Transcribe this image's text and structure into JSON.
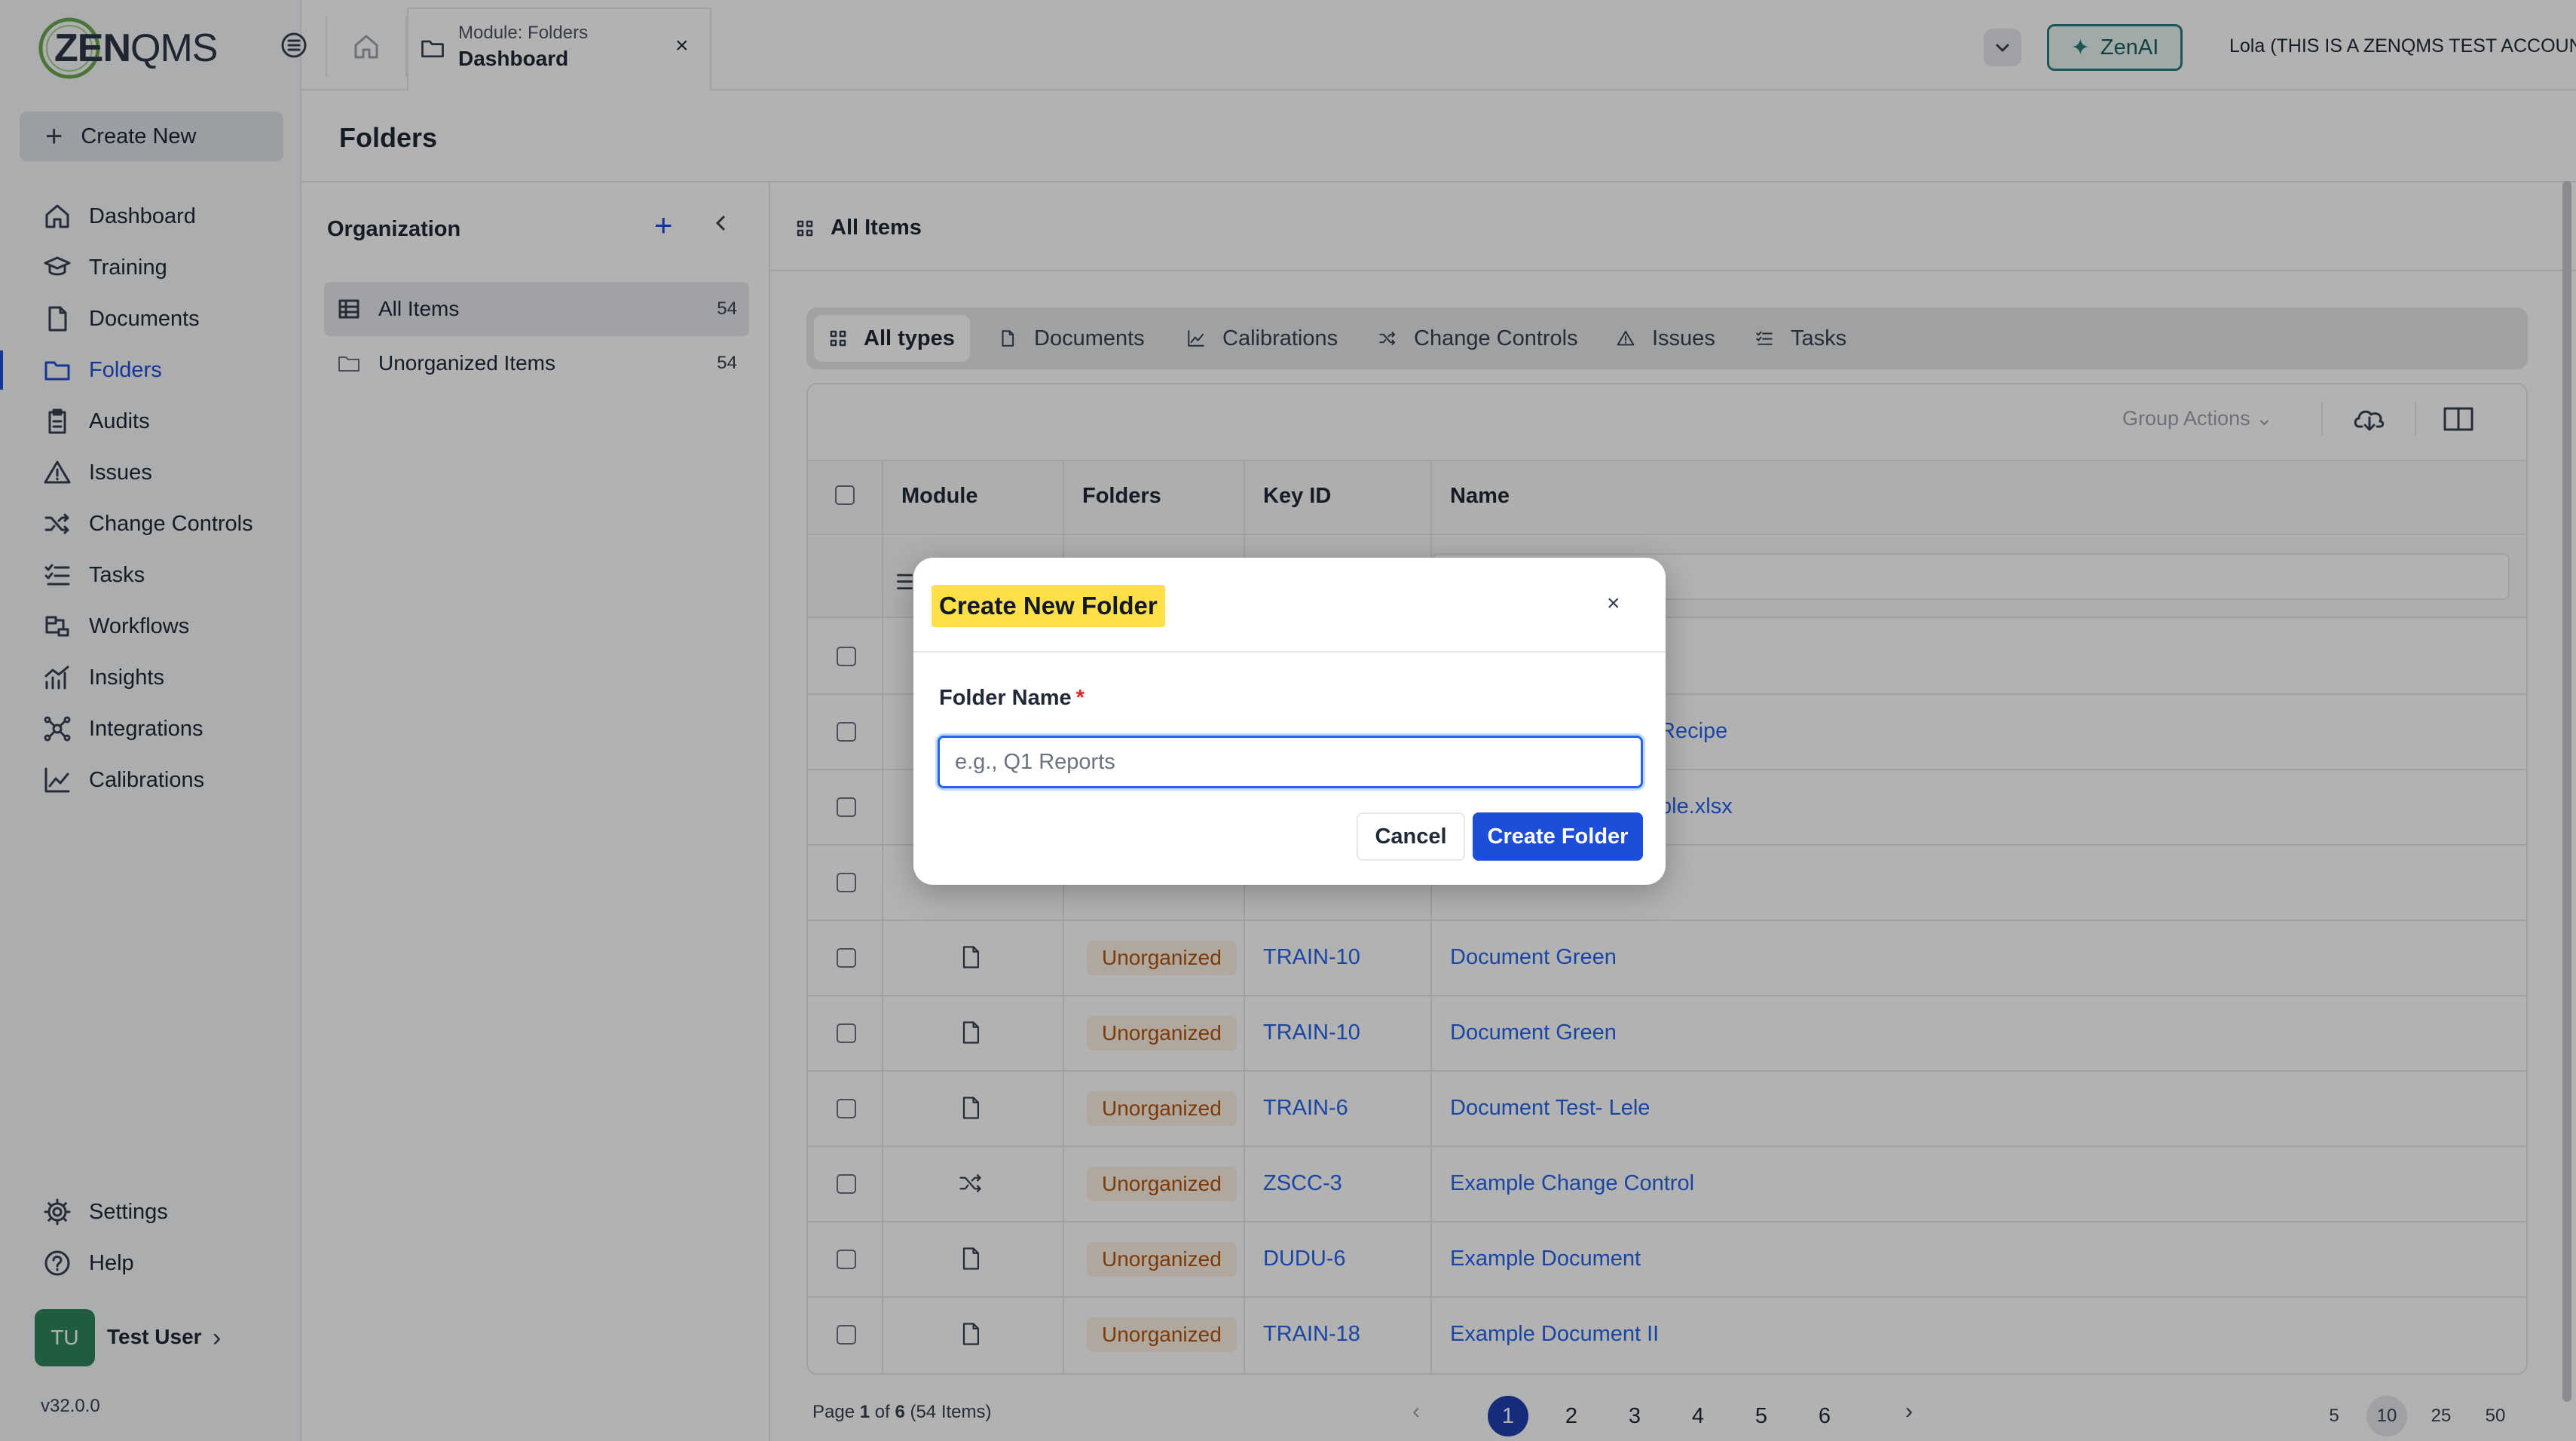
{
  "app": {
    "logo_zen": "ZEN",
    "logo_qms": "QMS"
  },
  "sidebar": {
    "create_new": "Create New",
    "items": [
      {
        "label": "Dashboard",
        "icon": "home-icon"
      },
      {
        "label": "Training",
        "icon": "graduation-cap-icon"
      },
      {
        "label": "Documents",
        "icon": "document-icon"
      },
      {
        "label": "Folders",
        "icon": "folder-icon",
        "active": true
      },
      {
        "label": "Audits",
        "icon": "clipboard-icon"
      },
      {
        "label": "Issues",
        "icon": "warning-icon"
      },
      {
        "label": "Change Controls",
        "icon": "shuffle-icon"
      },
      {
        "label": "Tasks",
        "icon": "checklist-icon"
      },
      {
        "label": "Workflows",
        "icon": "workflow-icon"
      },
      {
        "label": "Insights",
        "icon": "insights-icon"
      },
      {
        "label": "Integrations",
        "icon": "integrations-icon"
      },
      {
        "label": "Calibrations",
        "icon": "chart-icon"
      }
    ],
    "settings": "Settings",
    "help": "Help",
    "user_initials": "TU",
    "user_name": "Test User",
    "version": "v32.0.0"
  },
  "topbar": {
    "tab_module": "Module: Folders",
    "tab_title": "Dashboard",
    "tab_close": "×",
    "zenai": "ZenAI",
    "account": "Lola (THIS IS A ZENQMS TEST ACCOUNT)"
  },
  "page": {
    "title": "Folders"
  },
  "organization": {
    "title": "Organization",
    "items": [
      {
        "label": "All Items",
        "count": "54"
      },
      {
        "label": "Unorganized Items",
        "count": "54"
      }
    ]
  },
  "content": {
    "heading": "All Items",
    "types": [
      "All types",
      "Documents",
      "Calibrations",
      "Change Controls",
      "Issues",
      "Tasks"
    ],
    "group_actions": "Group Actions",
    "columns": [
      "Module",
      "Folders",
      "Key ID",
      "Name"
    ],
    "partial_rows": [
      "Recipe",
      "ple.xlsx"
    ],
    "rows": [
      {
        "module_icon": "document-icon",
        "folder": "Unorganized",
        "key": "TRAIN-10",
        "name": "Document Green"
      },
      {
        "module_icon": "document-icon",
        "folder": "Unorganized",
        "key": "TRAIN-10",
        "name": "Document Green"
      },
      {
        "module_icon": "document-icon",
        "folder": "Unorganized",
        "key": "TRAIN-6",
        "name": "Document Test- Lele"
      },
      {
        "module_icon": "shuffle-icon",
        "folder": "Unorganized",
        "key": "ZSCC-3",
        "name": "Example Change Control"
      },
      {
        "module_icon": "document-icon",
        "folder": "Unorganized",
        "key": "DUDU-6",
        "name": "Example Document"
      },
      {
        "module_icon": "document-icon",
        "folder": "Unorganized",
        "key": "TRAIN-18",
        "name": "Example Document II"
      }
    ],
    "pager": {
      "info_prefix": "Page ",
      "page": "1",
      "of": " of ",
      "total_pages": "6",
      "items": " (54 Items)",
      "pages": [
        "1",
        "2",
        "3",
        "4",
        "5",
        "6"
      ],
      "prev": "‹",
      "next": "›",
      "sizes": [
        "5",
        "10",
        "25",
        "50"
      ]
    }
  },
  "modal": {
    "title": "Create New Folder",
    "close": "×",
    "field_label": "Folder Name",
    "required_mark": "*",
    "placeholder": "e.g., Q1 Reports",
    "value": "",
    "cancel": "Cancel",
    "submit": "Create Folder"
  },
  "colors": {
    "accent": "#1d4ed8",
    "badge_bg": "#fdf1e4",
    "badge_text": "#b45309",
    "highlight": "#fde047",
    "zenai": "#2c7a7b"
  }
}
